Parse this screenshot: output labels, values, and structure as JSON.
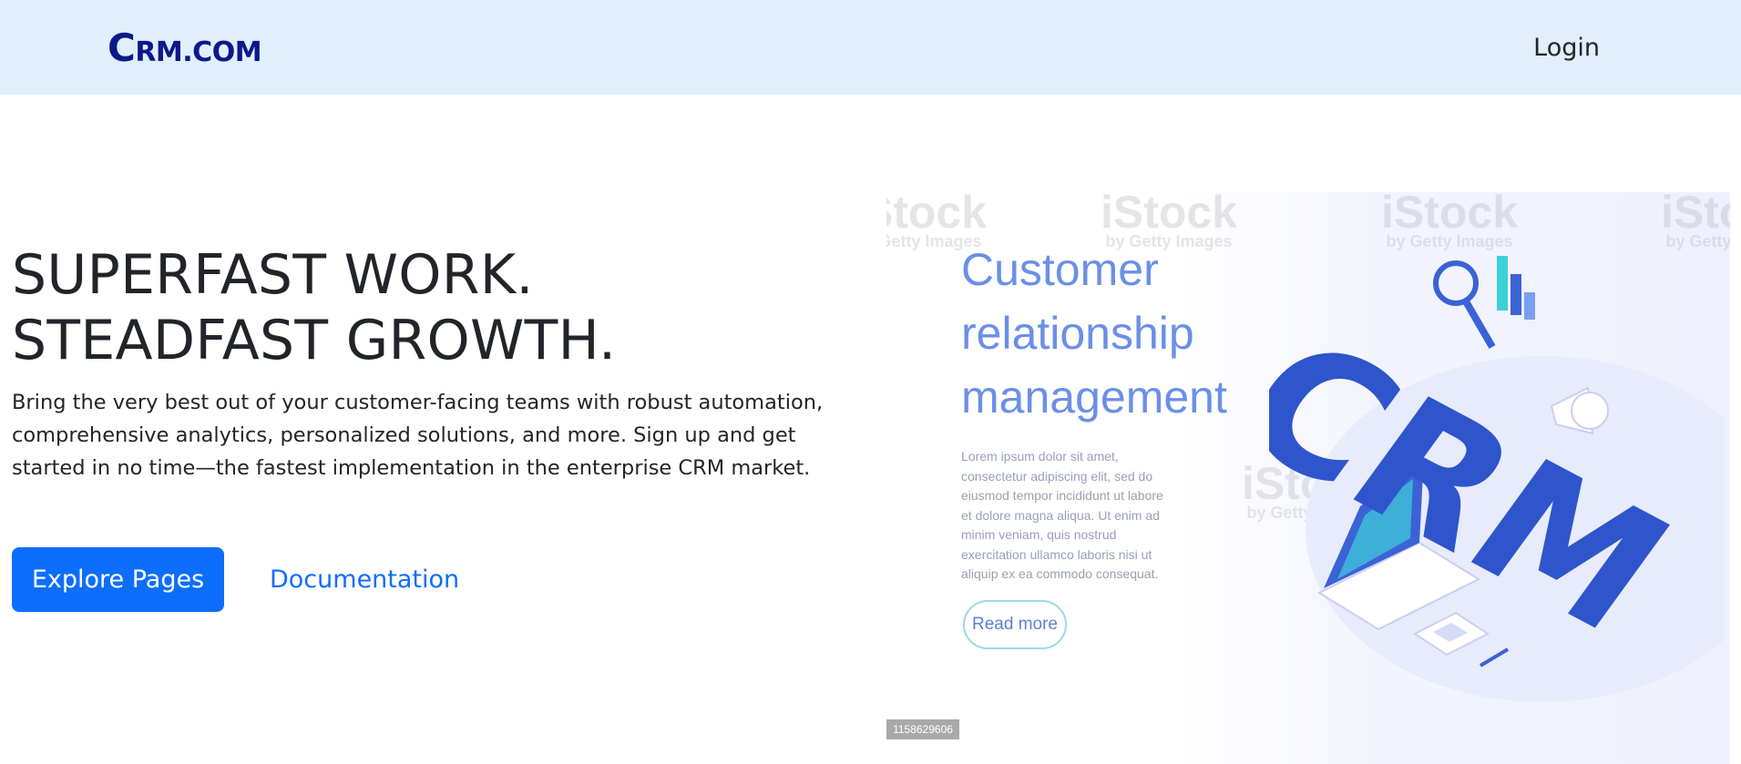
{
  "navbar": {
    "brand_big": "C",
    "brand_small": "RM.COM",
    "login_label": "Login"
  },
  "hero": {
    "headline": "SUPERFAST WORK. STEADFAST GROWTH.",
    "lead": "Bring the very best out of your customer-facing teams with robust automation, comprehensive analytics, personalized solutions, and more. Sign up and get started in no time—the fastest implementation in the enterprise CRM market.",
    "primary_button": "Explore Pages",
    "secondary_link": "Documentation"
  },
  "image": {
    "title_line1": "Customer",
    "title_line2": "relationship",
    "title_line3": "management",
    "lorem": "Lorem ipsum dolor sit amet, consectetur adipiscing elit, sed do eiusmod tempor incididunt ut labore et dolore magna aliqua. Ut enim ad minim veniam, quis nostrud exercitation ullamco laboris nisi ut aliquip ex ea commodo consequat.",
    "read_more": "Read more",
    "art_text": "CRM",
    "watermark": "iStock",
    "watermark_sub": "by Getty Images",
    "image_id": "1158629606"
  },
  "colors": {
    "navbar_bg": "#e1eefb",
    "brand": "#0a1a8a",
    "primary": "#0d6efd"
  }
}
